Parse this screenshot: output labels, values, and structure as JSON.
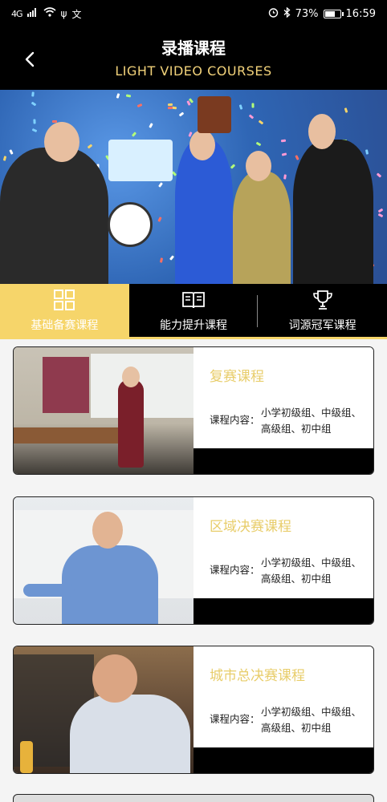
{
  "status_bar": {
    "network": "4G",
    "battery": "73%",
    "battery_level": 0.73,
    "time": "16:59"
  },
  "header": {
    "back_icon": "chevron-left-icon",
    "title": "录播课程",
    "subtitle": "LIGHT VIDEO COURSES"
  },
  "tabs": [
    {
      "label": "基础备赛课程",
      "icon": "grid-icon",
      "active": true
    },
    {
      "label": "能力提升课程",
      "icon": "book-icon",
      "active": false
    },
    {
      "label": "词源冠军课程",
      "icon": "trophy-icon",
      "active": false
    }
  ],
  "courses": [
    {
      "title": "复赛课程",
      "content_label": "课程内容：",
      "content": "小学初级组、中级组、高级组、初中组"
    },
    {
      "title": "区域决赛课程",
      "content_label": "课程内容：",
      "content": "小学初级组、中级组、高级组、初中组"
    },
    {
      "title": "城市总决赛课程",
      "content_label": "课程内容：",
      "content": "小学初级组、中级组、高级组、初中组"
    }
  ],
  "colors": {
    "accent": "#f6d56a",
    "title_gold": "#e8cd6a",
    "bar": "#000000"
  }
}
